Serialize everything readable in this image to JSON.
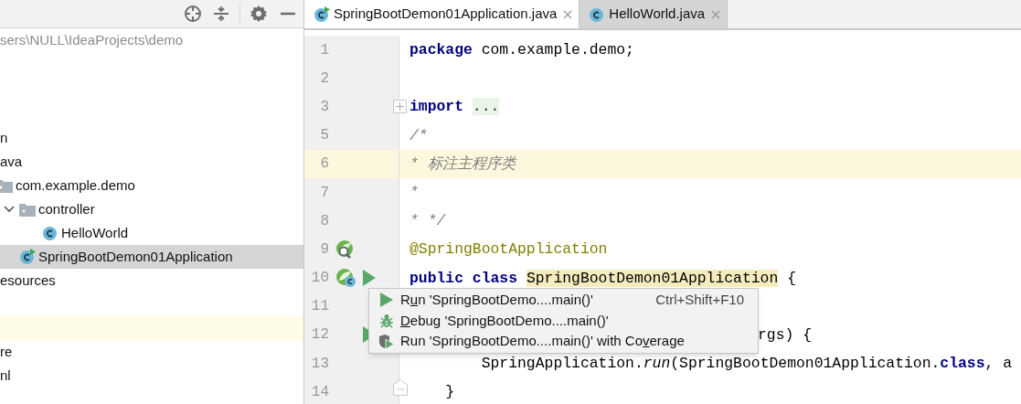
{
  "project_panel": {
    "path": "sers\\NULL\\IdeaProjects\\demo",
    "tree": [
      {
        "label": "n",
        "selected": false,
        "children": [
          {
            "label": "ava",
            "selected": false,
            "children": [
              {
                "label": "com.example.demo",
                "kind": "package",
                "selected": false,
                "children": [
                  {
                    "label": "controller",
                    "kind": "folder",
                    "expanded": true,
                    "selected": false,
                    "children": [
                      {
                        "label": "HelloWorld",
                        "kind": "class",
                        "selected": false
                      }
                    ]
                  },
                  {
                    "label": "SpringBootDemon01Application",
                    "kind": "runnable-class",
                    "selected": true
                  }
                ]
              }
            ]
          },
          {
            "label": "esources",
            "selected": false
          }
        ]
      },
      {
        "kind": "empty",
        "highlighted": false
      },
      {
        "kind": "empty",
        "highlighted": true
      },
      {
        "label": "re",
        "selected": false
      },
      {
        "label": "nl",
        "selected": false
      }
    ]
  },
  "tabs": [
    {
      "label": "SpringBootDemon01Application.java",
      "kind": "runnable-class",
      "selected": true
    },
    {
      "label": "HelloWorld.java",
      "kind": "class",
      "selected": false
    }
  ],
  "editor": {
    "lines": [
      {
        "number": "1",
        "current": false,
        "segments": [
          {
            "text": "package",
            "kind": "keyword"
          },
          {
            "text": " com.example.demo;",
            "kind": "plain"
          }
        ]
      },
      {
        "number": "2",
        "current": false
      },
      {
        "number": "3",
        "current": false,
        "fold": {
          "kind": "expand"
        },
        "segments": [
          {
            "text": "import",
            "kind": "keyword"
          },
          {
            "text": "...",
            "kind": "folded"
          }
        ]
      },
      {
        "number": "5",
        "current": false,
        "segments": [
          {
            "text": "/*",
            "kind": "comment"
          }
        ]
      },
      {
        "number": "6",
        "current": true,
        "segments": [
          {
            "text": "* 标注主程序类",
            "kind": "comment"
          }
        ]
      },
      {
        "number": "7",
        "current": false,
        "segments": [
          {
            "text": "*",
            "kind": "comment"
          }
        ]
      },
      {
        "number": "8",
        "current": false,
        "segments": [
          {
            "text": "* */",
            "kind": "comment"
          }
        ]
      },
      {
        "number": "9",
        "current": false,
        "gutter": [
          {
            "kind": "spring-search"
          }
        ],
        "segments": [
          {
            "text": "@SpringBootApplication",
            "kind": "annotation"
          }
        ]
      },
      {
        "number": "10",
        "current": false,
        "gutter": [
          {
            "kind": "spring-class"
          },
          {
            "kind": "run"
          }
        ],
        "segments": [
          {
            "text": "public class",
            "kind": "keyword"
          },
          {
            "text": "SpringBootDemon01Application",
            "kind": "usage"
          },
          {
            "text": " {",
            "kind": "plain"
          }
        ]
      },
      {
        "number": "11",
        "current": false
      },
      {
        "number": "12",
        "current": false,
        "partial": true,
        "gutter": [
          {
            "kind": "run"
          }
        ],
        "segments": [
          {
            "text": "rgs) {",
            "kind": "plain"
          }
        ]
      },
      {
        "number": "13",
        "current": false,
        "segments": [
          {
            "text": "        SpringApplication.",
            "kind": "plain"
          },
          {
            "text": "run",
            "kind": "static"
          },
          {
            "text": "(SpringBootDemon01Application.",
            "kind": "plain"
          },
          {
            "text": "class",
            "kind": "keyword"
          },
          {
            "text": ", a",
            "kind": "plain"
          }
        ]
      },
      {
        "number": "14",
        "current": false,
        "fold": {
          "kind": "collapse"
        },
        "segments": [
          {
            "text": "    }",
            "kind": "plain"
          }
        ]
      }
    ]
  },
  "popup_menu": [
    {
      "kind": "run",
      "before": "R",
      "mnemonic": "u",
      "after": "n 'SpringBootDemo....main()'",
      "shortcut": "Ctrl+Shift+F10"
    },
    {
      "kind": "debug",
      "mnemonic": "D",
      "after": "ebug 'SpringBootDemo....main()'"
    },
    {
      "kind": "coverage",
      "before": "Run 'SpringBootDemo....main()' with Co",
      "mnemonic": "v",
      "after": "erage"
    }
  ]
}
